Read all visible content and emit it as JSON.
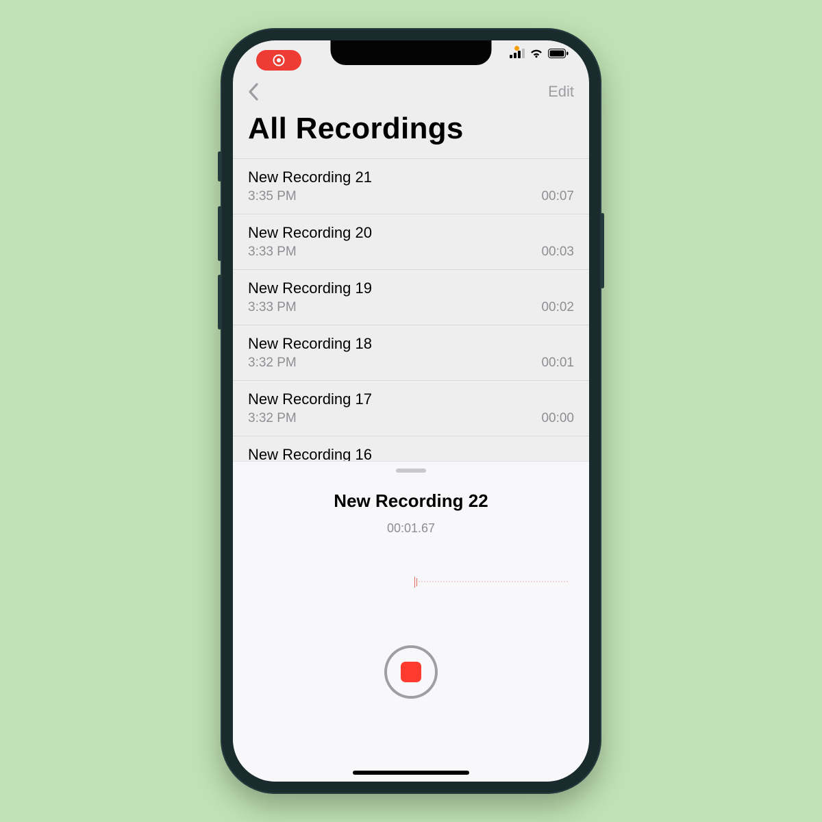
{
  "header": {
    "edit_label": "Edit",
    "page_title": "All Recordings"
  },
  "recordings": [
    {
      "name": "New Recording 21",
      "time": "3:35 PM",
      "duration": "00:07"
    },
    {
      "name": "New Recording 20",
      "time": "3:33 PM",
      "duration": "00:03"
    },
    {
      "name": "New Recording 19",
      "time": "3:33 PM",
      "duration": "00:02"
    },
    {
      "name": "New Recording 18",
      "time": "3:32 PM",
      "duration": "00:01"
    },
    {
      "name": "New Recording 17",
      "time": "3:32 PM",
      "duration": "00:00"
    },
    {
      "name": "New Recording 16",
      "time": "",
      "duration": ""
    }
  ],
  "active": {
    "title": "New Recording 22",
    "elapsed": "00:01.67"
  }
}
